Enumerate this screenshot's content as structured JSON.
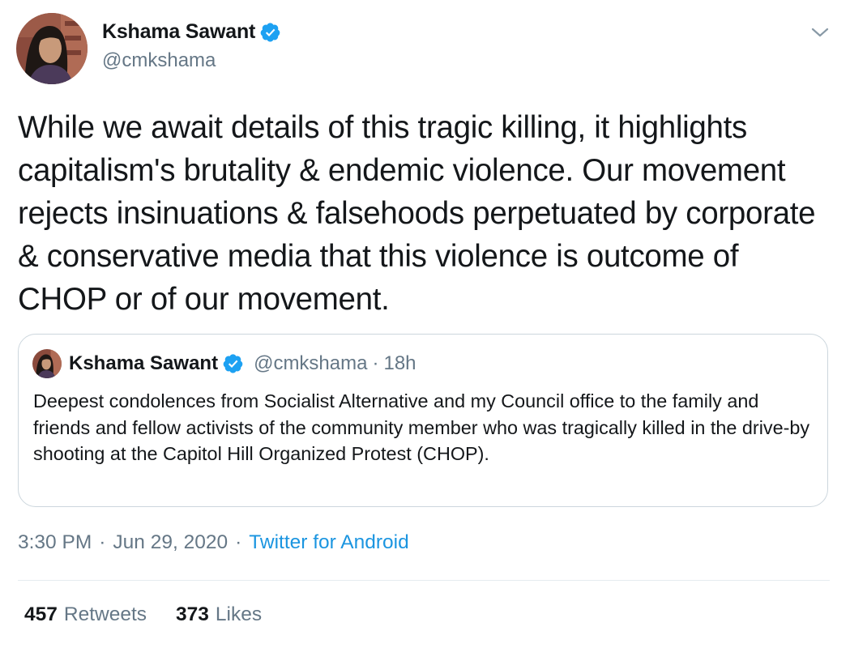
{
  "author": {
    "name": "Kshama Sawant",
    "handle": "@cmkshama",
    "verified_icon": "verified-badge-icon"
  },
  "menu_icon": "chevron-down-icon",
  "tweet": {
    "text": "While we await details of this tragic killing, it highlights capitalism's brutality & endemic violence. Our movement rejects insinuations & falsehoods perpetuated by corporate & conservative media that this violence is outcome of CHOP or of our movement."
  },
  "quoted_tweet": {
    "name": "Kshama Sawant",
    "handle": "@cmkshama",
    "separator": "·",
    "time": "18h",
    "text": "Deepest condolences from Socialist Alternative and my Council office to the family and friends and fellow activists of the community member who was tragically killed in the drive-by shooting at the Capitol Hill Organized Protest (CHOP)."
  },
  "meta": {
    "time": "3:30 PM",
    "separator": "·",
    "date": "Jun 29, 2020",
    "source": "Twitter for Android"
  },
  "stats": {
    "retweets_count": "457",
    "retweets_label": "Retweets",
    "likes_count": "373",
    "likes_label": "Likes"
  },
  "colors": {
    "text": "#14171a",
    "secondary": "#657786",
    "link": "#1b95e0",
    "verified": "#1da1f2",
    "border": "#ccd6dd"
  }
}
